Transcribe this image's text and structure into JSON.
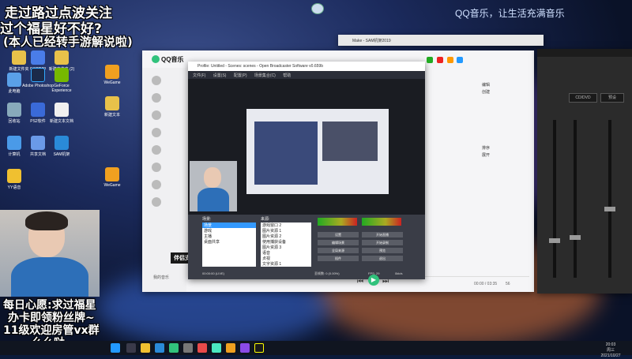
{
  "overlay": {
    "line1": "走过路过点波关注",
    "line2": "过个福星好不好?",
    "line3": "(本人已经转手游解说啦)",
    "bottom1": "每日心愿:求过福星",
    "bottom2": "办卡即领粉丝牌~",
    "bottom3": "11级欢迎房管vx群",
    "bottom4": "么么哒"
  },
  "qq_slogan": "QQ音乐，让生活充满音乐",
  "desktop_icons": [
    {
      "label": "新建文件夹",
      "color": "#e8c14a"
    },
    {
      "label": "cyanmgo",
      "color": "#4a7de8"
    },
    {
      "label": "新建文件夹 (2)",
      "color": "#e8c14a"
    },
    {
      "label": "此电脑",
      "color": "#5aa0e8"
    },
    {
      "label": "Adobe Photoshop",
      "color": "#1b2a4a"
    },
    {
      "label": "GeForce Experience",
      "color": "#76b900"
    },
    {
      "label": "回收站",
      "color": "#8ab"
    },
    {
      "label": "PS2软件",
      "color": "#3a6ad8"
    },
    {
      "label": "新建文本文档",
      "color": "#f0f0f0"
    },
    {
      "label": "计算机",
      "color": "#4a9ae8"
    },
    {
      "label": "共享文档",
      "color": "#6a9ae8"
    },
    {
      "label": "SAM机架",
      "color": "#2a8ad8"
    },
    {
      "label": "YY语音",
      "color": "#f0c030"
    },
    {
      "label": "WeGame",
      "color": "#f0a020"
    },
    {
      "label": "新建文本",
      "color": "#e8c14a"
    }
  ],
  "qq_music": {
    "app_name": "QQ音乐",
    "banner": "伴侣支",
    "bottom_left": "我的音乐",
    "right_buttons": [
      "编辑",
      "创建",
      "排序",
      "展开"
    ],
    "time": "00:00 / 03:35",
    "volume": "56"
  },
  "obs": {
    "title": "Profile: Untitled - Scenes: scenes - Open Broadcaster Software v0.659b",
    "menu": [
      "文件(F)",
      "设置(S)",
      "配置(P)",
      "场景集合(C)",
      "帮助"
    ],
    "scenes_label": "场景:",
    "scenes": [
      "场景",
      "游戏",
      "主播",
      "桌面共享"
    ],
    "sources_label": "来源:",
    "sources": [
      "游戏窗口 2",
      "图片资源 1",
      "图片资源 2",
      "使用捕获设备",
      "图片资源 3",
      "语音",
      "贞视",
      "文字资源 1"
    ],
    "buttons": [
      "设置",
      "开始直播",
      "编辑场景",
      "开始录制",
      "全局来源",
      "预览",
      "插件",
      "退出"
    ],
    "status_left": "00:00:00 (LIVE)",
    "status_fps": "FPS: 29",
    "status_kbps": "0kb/s",
    "status_drop": "丢帧数: 0 (0.00%)"
  },
  "daw": {
    "buttons": [
      "CD/DVD",
      "预设"
    ]
  },
  "sam_title": "Make - SAM机架2019",
  "taskbar": {
    "clock_time": "20:03",
    "clock_day": "周三",
    "clock_date": "2021/10/27"
  }
}
